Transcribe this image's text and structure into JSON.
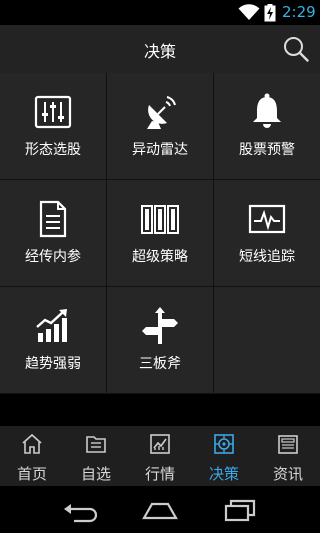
{
  "status_bar": {
    "time": "2:29",
    "accent_color": "#33b5e5"
  },
  "header": {
    "title": "决策",
    "search_icon": "search-icon"
  },
  "tools": [
    {
      "label": "形态选股",
      "icon": "sliders-icon"
    },
    {
      "label": "异动雷达",
      "icon": "radar-dish-icon"
    },
    {
      "label": "股票预警",
      "icon": "bell-icon"
    },
    {
      "label": "经传内参",
      "icon": "document-icon"
    },
    {
      "label": "超级策略",
      "icon": "columns-icon"
    },
    {
      "label": "短线追踪",
      "icon": "pulse-monitor-icon"
    },
    {
      "label": "趋势强弱",
      "icon": "trend-bars-icon"
    },
    {
      "label": "三板斧",
      "icon": "signpost-icon"
    }
  ],
  "tabs": [
    {
      "label": "首页",
      "icon": "home-icon",
      "active": false
    },
    {
      "label": "自选",
      "icon": "folder-icon",
      "active": false
    },
    {
      "label": "行情",
      "icon": "chart-icon",
      "active": false
    },
    {
      "label": "决策",
      "icon": "target-icon",
      "active": true
    },
    {
      "label": "资讯",
      "icon": "news-icon",
      "active": false
    }
  ],
  "colors": {
    "active_tab": "#3aa8e6",
    "cell_bg": "#262626",
    "header_bg": "#232323"
  }
}
